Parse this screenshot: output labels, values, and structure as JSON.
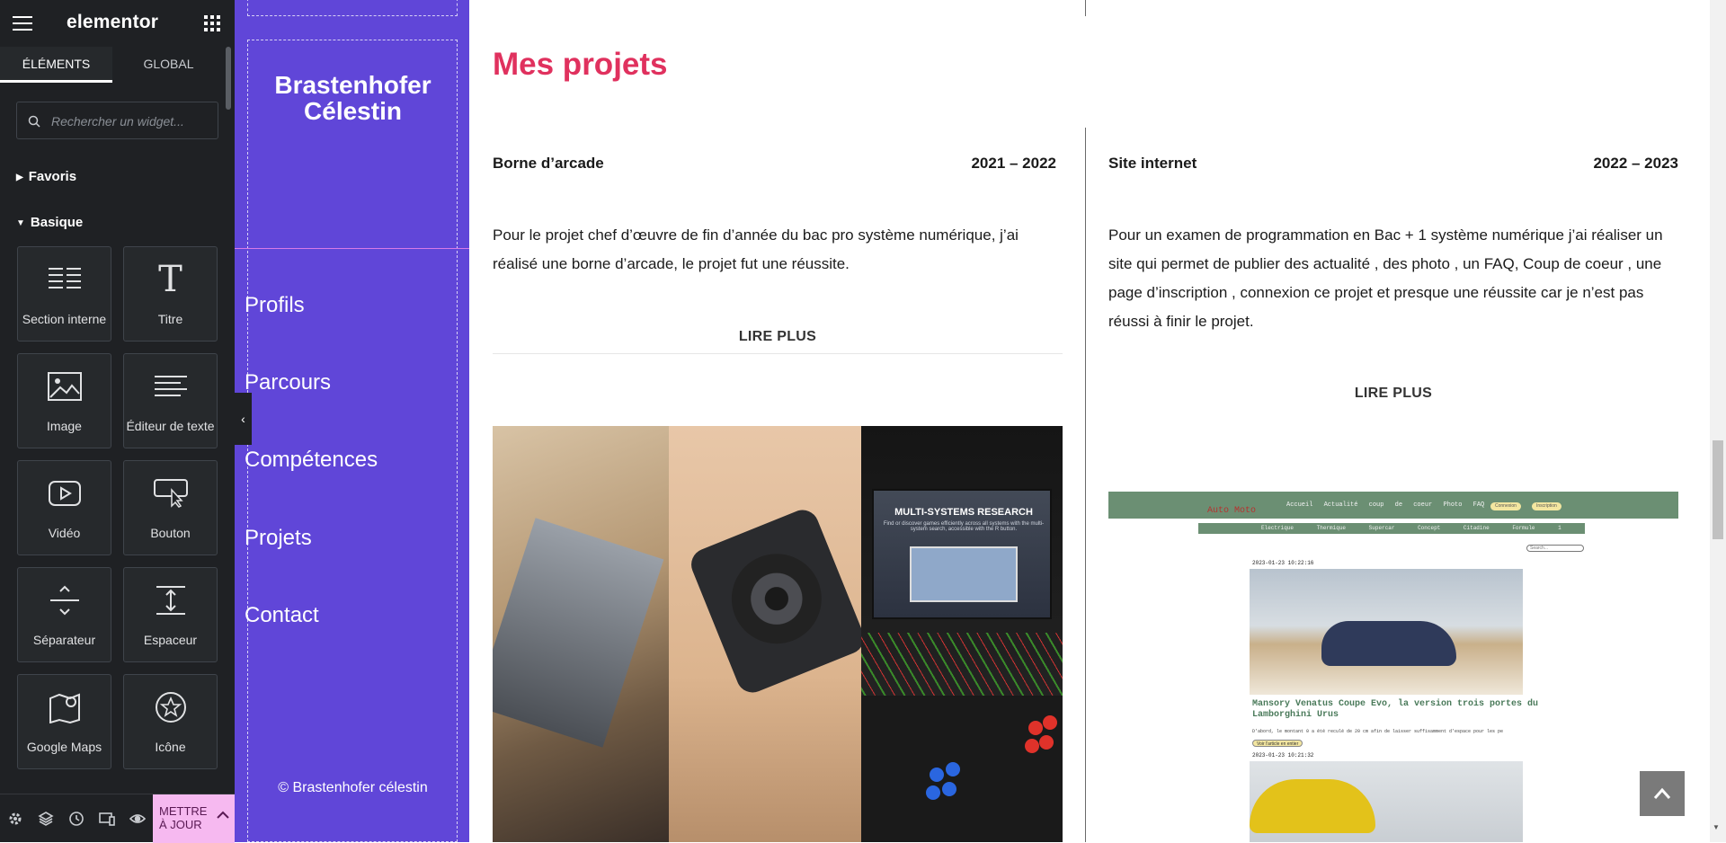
{
  "editor": {
    "logo": "elementor",
    "tabs": [
      {
        "label": "ÉLÉMENTS",
        "active": true
      },
      {
        "label": "GLOBAL",
        "active": false
      }
    ],
    "search_placeholder": "Rechercher un widget...",
    "categories": [
      {
        "label": "Favoris",
        "expanded": false
      },
      {
        "label": "Basique",
        "expanded": true
      }
    ],
    "widgets": [
      {
        "label": "Section interne",
        "icon": "inner-section-icon"
      },
      {
        "label": "Titre",
        "icon": "heading-icon"
      },
      {
        "label": "Image",
        "icon": "image-icon"
      },
      {
        "label": "Éditeur de texte",
        "icon": "text-editor-icon"
      },
      {
        "label": "Vidéo",
        "icon": "video-icon"
      },
      {
        "label": "Bouton",
        "icon": "button-icon"
      },
      {
        "label": "Séparateur",
        "icon": "divider-icon"
      },
      {
        "label": "Espaceur",
        "icon": "spacer-icon"
      },
      {
        "label": "Google Maps",
        "icon": "google-maps-icon"
      },
      {
        "label": "Icône",
        "icon": "star-icon"
      }
    ],
    "footer": {
      "icons": [
        "settings-icon",
        "navigator-icon",
        "history-icon",
        "responsive-icon",
        "preview-icon"
      ],
      "update_label": "METTRE À JOUR",
      "update_color": "#f6b9f0"
    },
    "colors": {
      "panel_bg": "#1f2124",
      "text": "#e0e1e3"
    }
  },
  "site": {
    "sidebar": {
      "name": "Brastenhofer Célestin",
      "nav": [
        "Profils",
        "Parcours",
        "Compétences",
        "Projets",
        "Contact"
      ],
      "copyright": "© Brastenhofer célestin",
      "bg_color": "#6046d8"
    },
    "section_title": "Mes projets",
    "title_color": "#e0315e",
    "projects": [
      {
        "name": "Borne d’arcade",
        "years": "2021 – 2022",
        "description": "Pour le projet chef d’œuvre de fin d’année du bac pro système numérique, j’ai réalisé une borne d’arcade, le projet fut une réussite.",
        "read_more": "LIRE PLUS",
        "image_screen_title": "MULTI-SYSTEMS RESEARCH",
        "image_screen_text": "Find or discover games efficiently across all systems with the multi-system search, accessible with the R button."
      },
      {
        "name": "Site internet",
        "years": "2022 – 2023",
        "description": "Pour un examen de programmation en Bac + 1 système numérique j’ai réaliser un site qui permet de publier des actualité , des photo , un FAQ, Coup de coeur , une page d’inscription , connexion ce projet et presque une réussite car je n’est pas réussi à finir le projet.",
        "read_more": "LIRE PLUS",
        "screenshot": {
          "brand": "Auto Moto",
          "nav": [
            "Accueil",
            "Actualité",
            "coup de coeur",
            "Photo",
            "FAQ"
          ],
          "buttons": [
            "Connexion",
            "Inscription"
          ],
          "subnav": [
            "Electrique",
            "Thermique",
            "Supercar",
            "Concept",
            "Citadine",
            "Formule 1"
          ],
          "search_placeholder": "Search...",
          "date1": "2023-01-23 10:22:16",
          "headline": "Mansory Venatus Coupe Evo, la version trois portes du Lamborghini Urus",
          "lead": "D'abord, le montant 0 a été reculé de 20 cm afin de laisser suffisamment d'espace pour les pe",
          "more": "Voir l'article en entier",
          "date2": "2023-01-23 10:21:32"
        }
      }
    ]
  }
}
